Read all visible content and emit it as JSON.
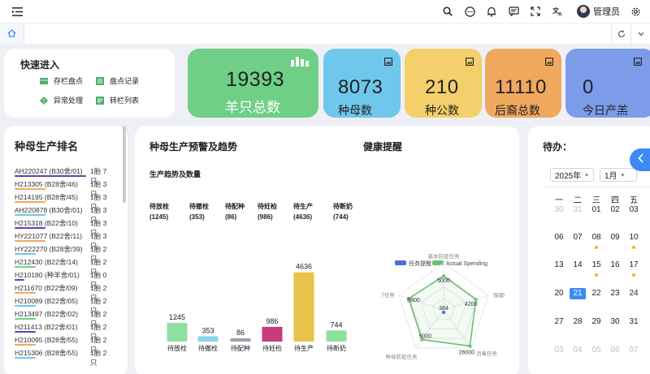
{
  "header": {
    "username": "管理员",
    "icons": [
      "menu-icon",
      "search-icon",
      "chat-icon",
      "bell-icon",
      "message-icon",
      "fullscreen-icon",
      "translate-icon",
      "settings-icon"
    ]
  },
  "tabs": {
    "home_icon": "home-icon",
    "right_icons": [
      "refresh-icon",
      "chevron-down-icon"
    ]
  },
  "quick_entry": {
    "title": "快速进入",
    "items": [
      {
        "label": "存栏盘点",
        "icon": "table-icon",
        "color": "#4cae6e"
      },
      {
        "label": "盘点记录",
        "icon": "spreadsheet-icon",
        "color": "#4cae6e"
      },
      {
        "label": "异常处理",
        "icon": "warning-diamond-icon",
        "color": "#4cae6e"
      },
      {
        "label": "转栏列表",
        "icon": "list-icon",
        "color": "#4cae6e"
      }
    ]
  },
  "stats": [
    {
      "value": "19393",
      "label": "羊只总数",
      "color": "#6fcf86",
      "icon": "bar-chart-icon"
    },
    {
      "value": "8073",
      "label": "种母数",
      "color": "#6fc7ec",
      "icon": "image-icon"
    },
    {
      "value": "210",
      "label": "种公数",
      "color": "#f4cf6b",
      "icon": "image-icon"
    },
    {
      "value": "11110",
      "label": "后裔总数",
      "color": "#f0a85f",
      "icon": "image-icon"
    },
    {
      "value": "0",
      "label": "今日产羔",
      "color": "#7c9be8",
      "icon": "image-icon"
    }
  ],
  "ranking": {
    "title": "种母生产排名",
    "rows": [
      {
        "name": "AH220247 (B30舍/01)",
        "count": "1胎 7只",
        "color": "#6a3fb0",
        "bar": 1.0
      },
      {
        "name": "H213305 (B28舍/46)",
        "count": "1胎 3只",
        "color": "#f0a85f",
        "bar": 0.43
      },
      {
        "name": "H214195 (B28舍/45)",
        "count": "1胎 3只",
        "color": "#f0a85f",
        "bar": 0.43
      },
      {
        "name": "AH220878 (B30舍/01)",
        "count": "1胎 3只",
        "color": "#6fc7ec",
        "bar": 0.43
      },
      {
        "name": "H215318 (B22舍/10)",
        "count": "1胎 3只",
        "color": "#6a3fb0",
        "bar": 0.43
      },
      {
        "name": "HY221077 (B22舍/11)",
        "count": "1胎 3只",
        "color": "#f0a85f",
        "bar": 0.43
      },
      {
        "name": "HY222270 (B28舍/39)",
        "count": "1胎 2只",
        "color": "#6fc7ec",
        "bar": 0.29
      },
      {
        "name": "H212430 (B22舍/14)",
        "count": "1胎 2只",
        "color": "#6fcf86",
        "bar": 0.29
      },
      {
        "name": "H210180 (种羊舍/01)",
        "count": "1胎 0只",
        "color": "#6a3fb0",
        "bar": 0.05
      },
      {
        "name": "H211670 (B22舍/09)",
        "count": "1胎 2只",
        "color": "#f0a85f",
        "bar": 0.29
      },
      {
        "name": "H210089 (B22舍/05)",
        "count": "1胎 2只",
        "color": "#6fc7ec",
        "bar": 0.29
      },
      {
        "name": "H213497 (B22舍/02)",
        "count": "1胎 2只",
        "color": "#6fcf86",
        "bar": 0.29
      },
      {
        "name": "H211413 (B22舍/01)",
        "count": "1胎 2只",
        "color": "#6a3fb0",
        "bar": 0.29
      },
      {
        "name": "H210095 (B28舍/55)",
        "count": "1胎 2只",
        "color": "#f0a85f",
        "bar": 0.29
      },
      {
        "name": "H215306 (B28舍/55)",
        "count": "1胎 2只",
        "color": "#6fc7ec",
        "bar": 0.29
      }
    ]
  },
  "production": {
    "title": "种母生产预警及趋势",
    "subtitle": "生产趋势及数量",
    "metrics": [
      {
        "label": "待放栓",
        "value": "(1245)"
      },
      {
        "label": "待撤栓",
        "value": "(353)"
      },
      {
        "label": "待配种",
        "value": "(86)"
      },
      {
        "label": "待妊检",
        "value": "(986)"
      },
      {
        "label": "待生产",
        "value": "(4636)"
      },
      {
        "label": "待断奶",
        "value": "(744)"
      }
    ]
  },
  "health": {
    "title": "健康提醒"
  },
  "todo": {
    "title": "待办：",
    "year_select": "2025年",
    "month_select": "1月",
    "weekdays": [
      "一",
      "二",
      "三",
      "四",
      "五"
    ],
    "weeks": [
      [
        "30",
        "31",
        "01",
        "02",
        "03"
      ],
      [
        "06",
        "07",
        "08",
        "09",
        "10"
      ],
      [
        "13",
        "14",
        "15",
        "16",
        "17"
      ],
      [
        "20",
        "21",
        "22",
        "23",
        "24"
      ],
      [
        "27",
        "28",
        "29",
        "30",
        "31"
      ],
      [
        "03",
        "04",
        "05",
        "06",
        "07"
      ]
    ],
    "today": "21"
  },
  "chart_data": [
    {
      "type": "bar",
      "categories": [
        "待放栓",
        "待撤栓",
        "待配种",
        "待妊检",
        "待生产",
        "待断奶"
      ],
      "values": [
        1245,
        353,
        86,
        986,
        4636,
        744
      ],
      "title": "",
      "xlabel": "",
      "ylabel": "",
      "ylim": [
        0,
        5000
      ],
      "grid": false,
      "colors": [
        "#8fe0a0",
        "#86d7e6",
        "#9aa3b4",
        "#c83a7a",
        "#e9c24a",
        "#8fe0a0"
      ]
    },
    {
      "type": "radar",
      "title": "",
      "legend": [
        "任务提醒",
        "Actual Spending"
      ],
      "legend_position": "top",
      "indicators": [
        "基本防疫任务",
        "保健!",
        "消毒任务",
        "种母防疫任务",
        "7任务"
      ],
      "series": [
        {
          "name": "任务提醒",
          "values": [
            384,
            null,
            null,
            null,
            null
          ],
          "color": "#4a6fd8"
        },
        {
          "name": "Actual Spending",
          "values": [
            5000,
            4200,
            26000,
            5000,
            8800
          ],
          "color": "#6cc070"
        }
      ]
    }
  ]
}
